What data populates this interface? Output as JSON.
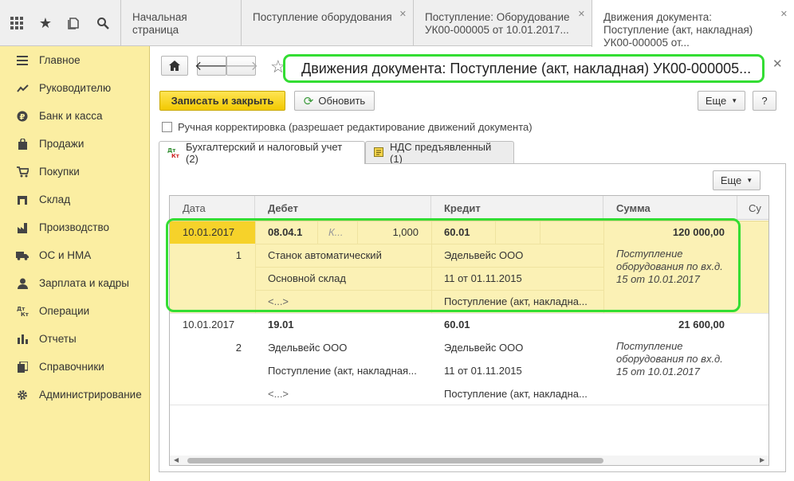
{
  "topbar": {
    "icons": [
      "apps-grid-icon",
      "star-icon",
      "history-icon",
      "search-icon"
    ],
    "tabs": [
      {
        "label": "Начальная страница",
        "closable": false
      },
      {
        "label": "Поступление оборудования",
        "closable": true
      },
      {
        "label": "Поступление: Оборудование УК00-000005 от 10.01.2017...",
        "closable": true
      },
      {
        "label": "Движения документа: Поступление (акт, накладная) УК00-000005 от...",
        "closable": true
      }
    ]
  },
  "sidebar": {
    "items": [
      {
        "label": "Главное",
        "icon": "menu-lines-icon"
      },
      {
        "label": "Руководителю",
        "icon": "trend-chart-icon"
      },
      {
        "label": "Банк и касса",
        "icon": "ruble-coin-icon"
      },
      {
        "label": "Продажи",
        "icon": "shopping-bag-icon"
      },
      {
        "label": "Покупки",
        "icon": "shopping-cart-icon"
      },
      {
        "label": "Склад",
        "icon": "warehouse-icon"
      },
      {
        "label": "Производство",
        "icon": "factory-icon"
      },
      {
        "label": "ОС и НМА",
        "icon": "truck-icon"
      },
      {
        "label": "Зарплата и кадры",
        "icon": "person-icon"
      },
      {
        "label": "Операции",
        "icon": "dt-kt-icon"
      },
      {
        "label": "Отчеты",
        "icon": "bar-chart-icon"
      },
      {
        "label": "Справочники",
        "icon": "book-icon"
      },
      {
        "label": "Администрирование",
        "icon": "gear-icon"
      }
    ]
  },
  "toolbar": {
    "title": "Движения документа: Поступление (акт, накладная) УК00-000005...",
    "save_close": "Записать и закрыть",
    "refresh": "Обновить",
    "more": "Еще",
    "help": "?",
    "manual_edit_label": "Ручная корректировка (разрешает редактирование движений документа)"
  },
  "page_tabs": [
    {
      "label": "Бухгалтерский и налоговый учет (2)",
      "icon_text": "Дт Кт",
      "active": true
    },
    {
      "label": "НДС предъявленный (1)",
      "icon_text": "",
      "active": false
    }
  ],
  "grid": {
    "more": "Еще",
    "columns": [
      "Дата",
      "Дебет",
      "Кредит",
      "Сумма",
      "Су"
    ],
    "rows": [
      {
        "date": "10.01.2017",
        "number": "1",
        "debit_account": "08.04.1",
        "debit_qty_label": "К...",
        "debit_qty": "1,000",
        "debit_sub1": "Станок автоматический",
        "debit_sub2": "Основной склад",
        "debit_sub3": "<...>",
        "credit_account": "60.01",
        "credit_sub1": "Эдельвейс ООО",
        "credit_sub2": "11 от 01.11.2015",
        "credit_sub3": "Поступление (акт, накладна...",
        "amount": "120 000,00",
        "content": "Поступление оборудования по вх.д. 15 от 10.01.2017"
      },
      {
        "date": "10.01.2017",
        "number": "2",
        "debit_account": "19.01",
        "debit_sub1": "Эдельвейс ООО",
        "debit_sub2": "Поступление (акт, накладная...",
        "debit_sub3": "<...>",
        "credit_account": "60.01",
        "credit_sub1": "Эдельвейс ООО",
        "credit_sub2": "11 от 01.11.2015",
        "credit_sub3": "Поступление (акт, накладна...",
        "amount": "21 600,00",
        "content": "Поступление оборудования по вх.д. 15 от 10.01.2017"
      }
    ]
  },
  "colors": {
    "sidebar_bg": "#fbeea2",
    "primary_button": "#f2c900",
    "selected_row": "#fbf1b5",
    "highlight_outline": "#33dd33"
  }
}
